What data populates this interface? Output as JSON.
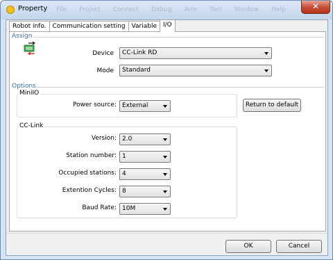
{
  "window": {
    "title": "Property",
    "close_label": "✕",
    "background_menu": [
      "File",
      "Project",
      "Connect",
      "Debug",
      "Arm",
      "Tool",
      "Window",
      "Help"
    ]
  },
  "tabs": [
    {
      "label": "Robot info."
    },
    {
      "label": "Communication setting"
    },
    {
      "label": "Variable"
    },
    {
      "label": "I/O"
    }
  ],
  "active_tab": "I/O",
  "assign": {
    "section_label": "Assign",
    "device_label": "Device",
    "device_value": "CC-Link RD",
    "mode_label": "Mode",
    "mode_value": "Standard"
  },
  "options": {
    "section_label": "Options",
    "miniio": {
      "group_label": "MiniIO",
      "power_source_label": "Power source:",
      "power_source_value": "External"
    },
    "return_default_label": "Return to default",
    "cclink": {
      "group_label": "CC-Link",
      "version_label": "Version:",
      "version_value": "2.0",
      "station_number_label": "Station number:",
      "station_number_value": "1",
      "occupied_stations_label": "Occupied stations:",
      "occupied_stations_value": "4",
      "extention_cycles_label": "Extention Cycles:",
      "extention_cycles_value": "8",
      "baud_rate_label": "Baud Rate:",
      "baud_rate_value": "10M"
    }
  },
  "footer": {
    "ok_label": "OK",
    "cancel_label": "Cancel"
  },
  "colors": {
    "section_accent": "#3a6ea5",
    "title_bar": "#c4d6ec",
    "close_button": "#c75038"
  }
}
